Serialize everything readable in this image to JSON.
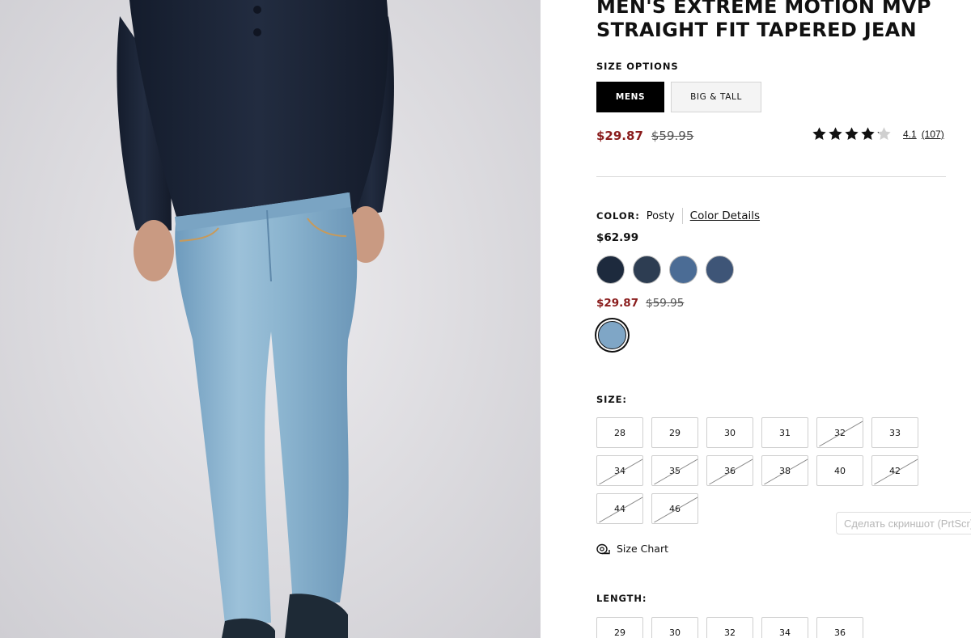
{
  "product": {
    "title": "MEN'S EXTREME MOTION MVP STRAIGHT FIT TAPERED JEAN"
  },
  "size_options": {
    "label": "SIZE OPTIONS",
    "tabs": [
      {
        "label": "MENS",
        "active": true
      },
      {
        "label": "BIG & TALL",
        "active": false
      }
    ]
  },
  "pricing": {
    "sale": "$29.87",
    "original": "$59.95"
  },
  "rating": {
    "stars": 4.1,
    "value": "4.1",
    "count": "(107)"
  },
  "color": {
    "label": "COLOR:",
    "selected_name": "Posty",
    "details_link": "Color Details",
    "group_full_price": "$62.99",
    "full_price_swatches": [
      {
        "color": "#1d2a3d"
      },
      {
        "color": "#2d3d52"
      },
      {
        "color": "#4b6c95"
      },
      {
        "color": "#3e5577"
      }
    ],
    "sale_price": "$29.87",
    "sale_original": "$59.95",
    "sale_swatches": [
      {
        "color": "#7fa6c6",
        "selected": true
      }
    ]
  },
  "size": {
    "label": "SIZE:",
    "options": [
      {
        "label": "28",
        "available": true
      },
      {
        "label": "29",
        "available": true
      },
      {
        "label": "30",
        "available": true
      },
      {
        "label": "31",
        "available": true
      },
      {
        "label": "32",
        "available": false
      },
      {
        "label": "33",
        "available": true
      },
      {
        "label": "34",
        "available": false
      },
      {
        "label": "35",
        "available": false
      },
      {
        "label": "36",
        "available": false
      },
      {
        "label": "38",
        "available": false
      },
      {
        "label": "40",
        "available": true
      },
      {
        "label": "42",
        "available": false
      },
      {
        "label": "44",
        "available": false
      },
      {
        "label": "46",
        "available": false
      }
    ],
    "chart_label": "Size Chart"
  },
  "length": {
    "label": "LENGTH:",
    "options": [
      {
        "label": "29"
      },
      {
        "label": "30"
      },
      {
        "label": "32"
      },
      {
        "label": "34"
      },
      {
        "label": "36"
      }
    ]
  },
  "overlay": {
    "screenshot_hint": "Сделать скриншот (PrtScr)"
  },
  "icons": {
    "size_chart": "tape-measure-icon",
    "star": "star-icon"
  },
  "colors": {
    "sale_red": "#8a1c1c",
    "active_tab": "#000000"
  }
}
